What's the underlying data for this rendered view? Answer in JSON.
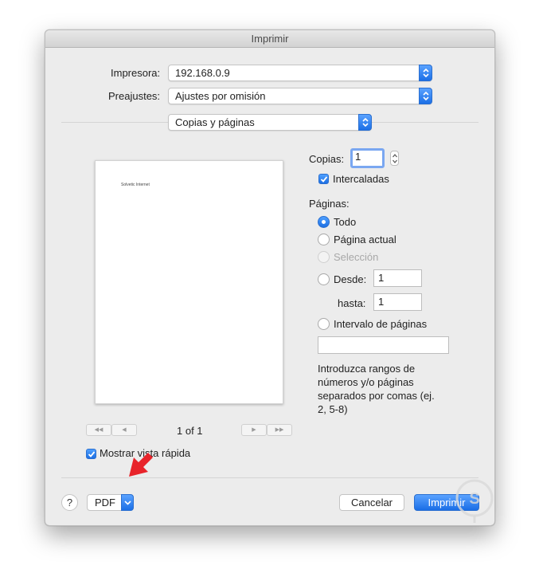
{
  "window": {
    "title": "Imprimir"
  },
  "printer": {
    "label": "Impresora:",
    "value": "192.168.0.9"
  },
  "presets": {
    "label": "Preajustes:",
    "value": "Ajustes por omisión"
  },
  "section": {
    "value": "Copias y páginas"
  },
  "preview": {
    "page_text": "Solvetic Internet",
    "pager": "1 of 1",
    "nav_first": "◀◀",
    "nav_prev": "◀",
    "nav_next": "▶",
    "nav_last": "▶▶"
  },
  "copies": {
    "label": "Copias:",
    "value": "1",
    "collate_label": "Intercaladas"
  },
  "pages": {
    "label": "Páginas:",
    "all": "Todo",
    "current": "Página actual",
    "selection": "Selección",
    "from": "Desde:",
    "from_value": "1",
    "to": "hasta:",
    "to_value": "1",
    "range": "Intervalo de páginas",
    "range_value": "",
    "hint": [
      "Introduzca rangos de",
      "números y/o páginas",
      "separados por comas (ej.",
      "2, 5-8)"
    ]
  },
  "quick_preview": {
    "label": "Mostrar vista rápida"
  },
  "footer": {
    "help": "?",
    "pdf": "PDF",
    "cancel": "Cancelar",
    "print": "Imprimir"
  }
}
